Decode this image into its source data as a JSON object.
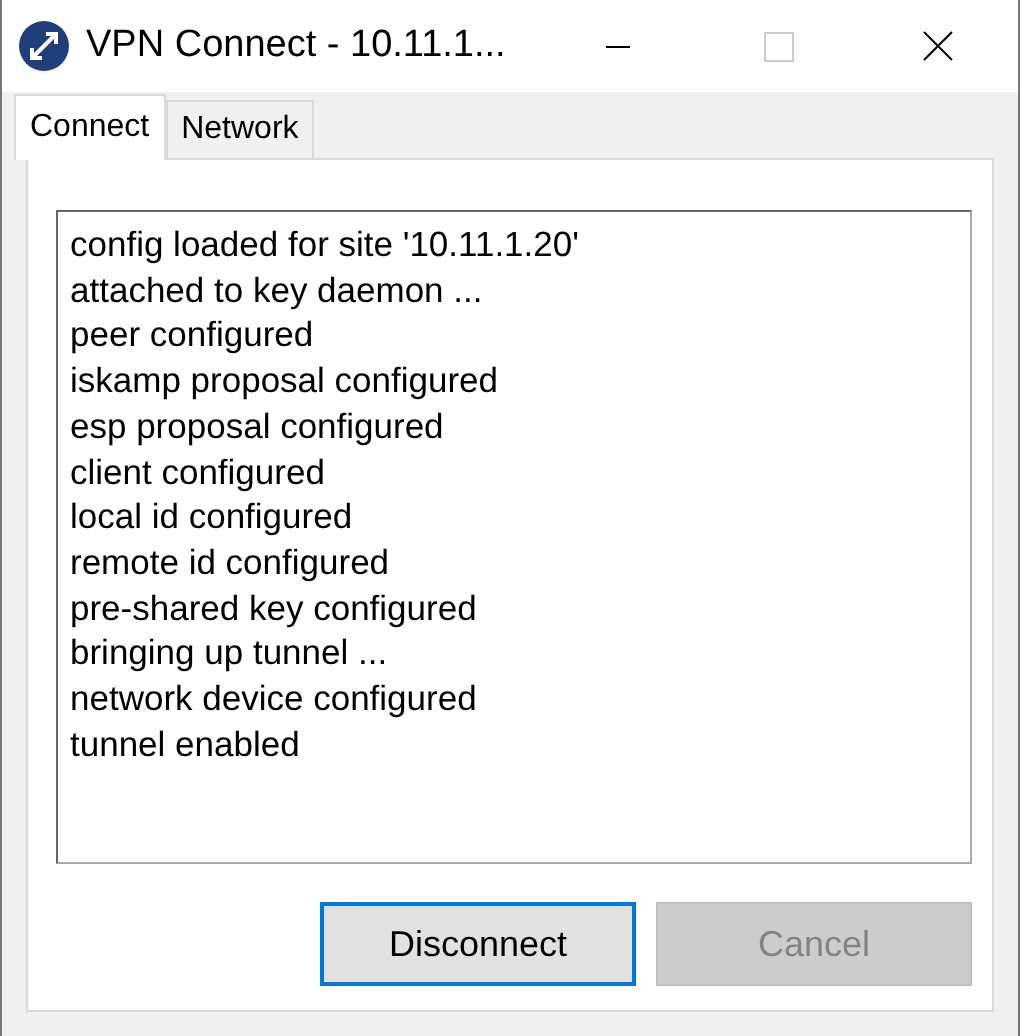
{
  "window": {
    "title": "VPN Connect - 10.11.1..."
  },
  "tabs": [
    {
      "label": "Connect",
      "selected": true
    },
    {
      "label": "Network",
      "selected": false
    }
  ],
  "log": [
    "config loaded for site '10.11.1.20'",
    "attached to key daemon ...",
    "peer configured",
    "iskamp proposal configured",
    "esp proposal configured",
    "client configured",
    "local id configured",
    "remote id configured",
    "pre-shared key configured",
    "bringing up tunnel ...",
    "network device configured",
    "tunnel enabled"
  ],
  "buttons": [
    {
      "label": "Disconnect",
      "disabled": false,
      "focused": true
    },
    {
      "label": "Cancel",
      "disabled": true,
      "focused": false
    }
  ]
}
